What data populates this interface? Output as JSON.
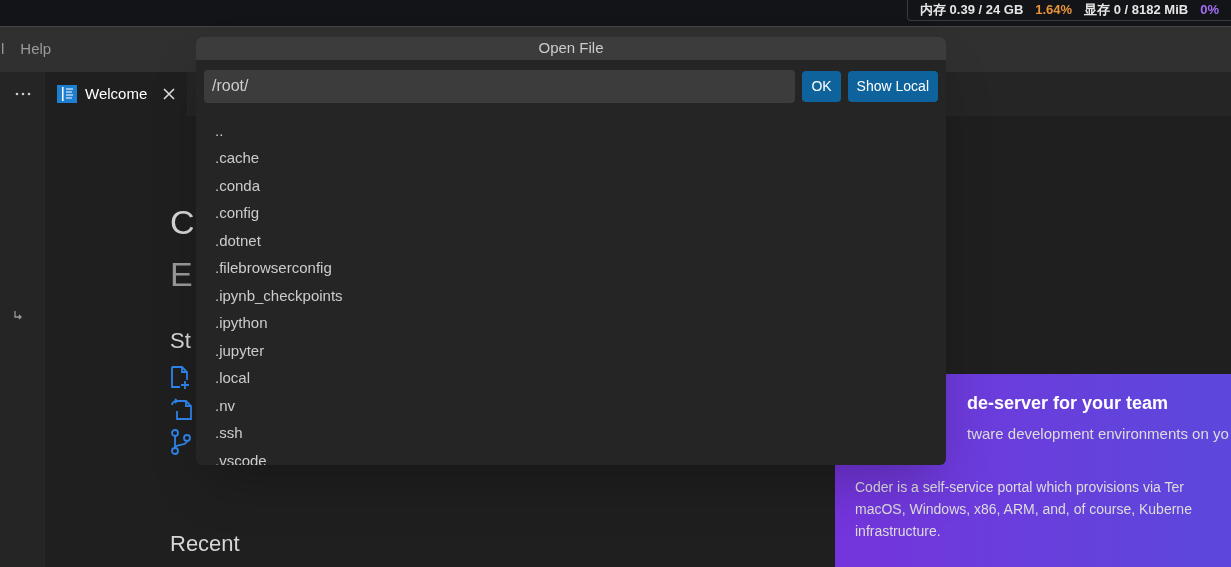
{
  "status_bar": {
    "items": [
      {
        "text": "内存 0.39 / 24 GB",
        "color": "#e6e6e6"
      },
      {
        "text": "1.64%",
        "color": "#e8923a"
      },
      {
        "text": "显存 0 / 8182 MiB",
        "color": "#e6e6e6"
      },
      {
        "text": "0%",
        "color": "#a36ef5"
      }
    ]
  },
  "menu": [
    "l",
    "Help"
  ],
  "tabs": [
    {
      "label": "Welcome",
      "selected": true
    }
  ],
  "welcome": {
    "title": "C",
    "subtitle": "E",
    "start_heading": "St",
    "recent_heading": "Recent"
  },
  "promo": {
    "title": "de-server for your team",
    "subtitle": "tware development environments on yo",
    "body": [
      "Coder is a self-service portal which provisions via Ter",
      "macOS, Windows, x86, ARM, and, of course, Kuberne",
      "infrastructure."
    ]
  },
  "dialog": {
    "title": "Open File",
    "path": "/root/",
    "buttons": [
      "OK",
      "Show Local"
    ],
    "entries": [
      "..",
      ".cache",
      ".conda",
      ".config",
      ".dotnet",
      ".filebrowserconfig",
      ".ipynb_checkpoints",
      ".ipython",
      ".jupyter",
      ".local",
      ".nv",
      ".ssh",
      ".vscode"
    ]
  }
}
